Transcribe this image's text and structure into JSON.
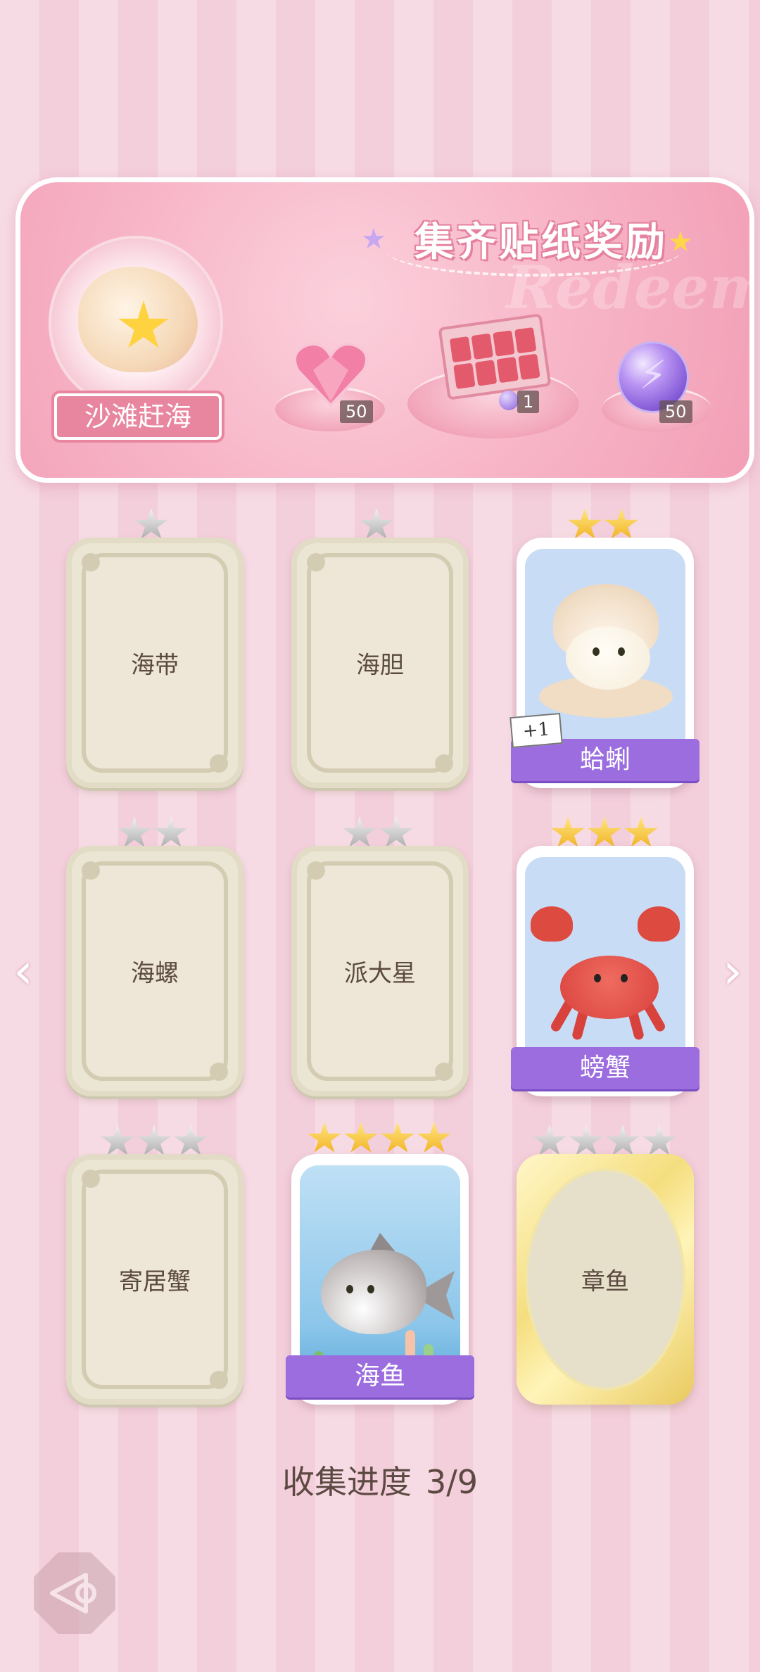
{
  "banner": {
    "title": "集齐贴纸奖励",
    "watermark": "Redeem",
    "event_name": "沙滩赶海",
    "rewards": [
      {
        "icon": "pink-heart-gem-icon",
        "count": "50"
      },
      {
        "icon": "gift-box-icon",
        "count": "1"
      },
      {
        "icon": "energy-orb-icon",
        "count": "50"
      }
    ]
  },
  "cards": [
    {
      "name": "海带",
      "stars": 1,
      "state": "locked"
    },
    {
      "name": "海胆",
      "stars": 1,
      "state": "locked"
    },
    {
      "name": "蛤蜊",
      "stars": 2,
      "state": "owned",
      "badge": "+1"
    },
    {
      "name": "海螺",
      "stars": 2,
      "state": "locked"
    },
    {
      "name": "派大星",
      "stars": 2,
      "state": "locked"
    },
    {
      "name": "螃蟹",
      "stars": 3,
      "state": "owned"
    },
    {
      "name": "寄居蟹",
      "stars": 3,
      "state": "locked"
    },
    {
      "name": "海鱼",
      "stars": 4,
      "state": "owned"
    },
    {
      "name": "章鱼",
      "stars": 4,
      "state": "locked-gold"
    }
  ],
  "progress": {
    "label": "收集进度",
    "value": "3/9"
  },
  "nav": {
    "prev_icon": "‹",
    "next_icon": "›"
  },
  "colors": {
    "ribbon": "#9b6ddf",
    "banner": "#f7b3c6",
    "background": "#f7dbe4"
  }
}
